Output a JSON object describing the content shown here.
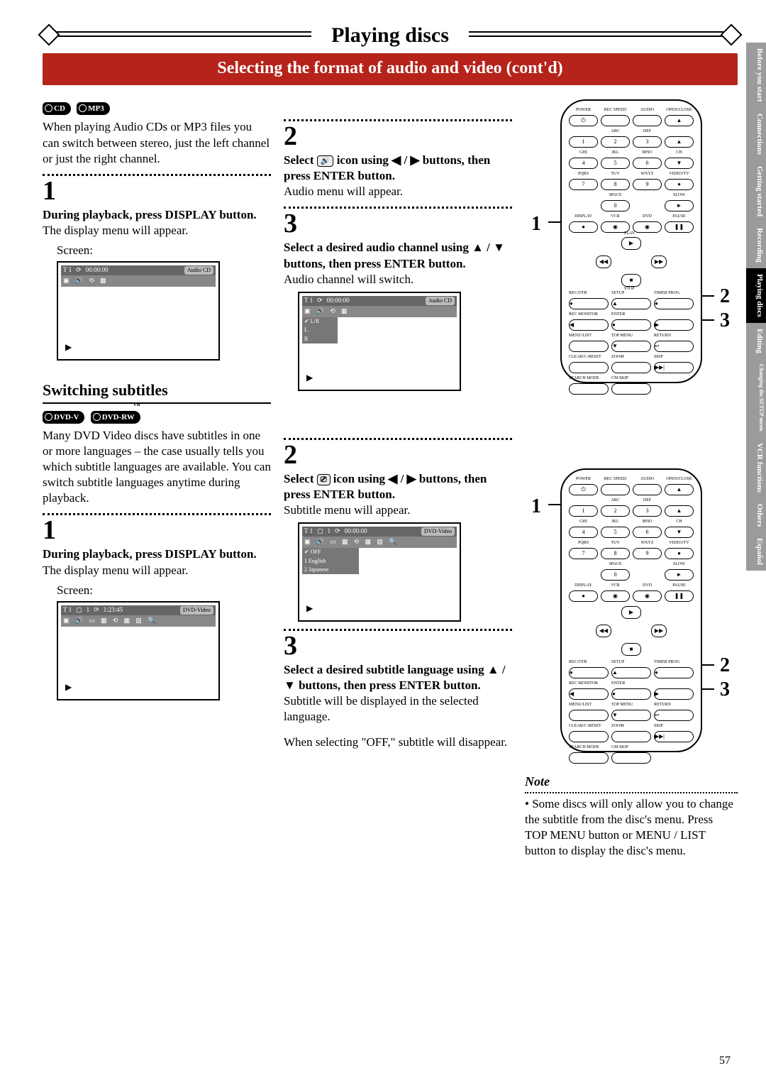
{
  "banner": {
    "title": "Playing discs"
  },
  "section_bar": "Selecting the format of audio and video (cont'd)",
  "tabs": [
    {
      "label": "Before you start",
      "active": false
    },
    {
      "label": "Connections",
      "active": false
    },
    {
      "label": "Getting started",
      "active": false
    },
    {
      "label": "Recording",
      "active": false
    },
    {
      "label": "Playing discs",
      "active": true
    },
    {
      "label": "Editing",
      "active": false
    },
    {
      "label": "Changing the SETUP menu",
      "active": false
    },
    {
      "label": "VCR functions",
      "active": false
    },
    {
      "label": "Others",
      "active": false
    },
    {
      "label": "Español",
      "active": false
    }
  ],
  "sec1": {
    "badges": [
      "CD",
      "MP3"
    ],
    "intro": "When playing Audio CDs or MP3 files you can switch between stereo, just the left channel or just the right channel.",
    "steps": {
      "1": {
        "n": "1",
        "bold": "During playback, press DISPLAY button.",
        "text": "The display menu will appear.",
        "screen_label": "Screen:",
        "screen": {
          "track": "T  1",
          "time": "00:00:00",
          "type": "Audio CD"
        }
      },
      "2": {
        "n": "2",
        "bold_pre": "Select ",
        "bold_mid": " icon using ",
        "arrows": "◀ / ▶",
        "bold_post": " buttons, then press ENTER button.",
        "text": "Audio menu will appear."
      },
      "3": {
        "n": "3",
        "bold": "Select a desired audio channel using ▲ / ▼ buttons, then press ENTER button.",
        "text": "Audio channel will switch.",
        "screen": {
          "track": "T  1",
          "time": "00:00:00",
          "type": "Audio CD",
          "menu": [
            "✔ L/R",
            "  L",
            "  R"
          ]
        }
      }
    }
  },
  "sec2": {
    "title": "Switching subtitles",
    "badges": [
      "DVD-V",
      "DVD-RW"
    ],
    "vr_label": "VR",
    "intro": "Many DVD Video discs have subtitles in one or more languages – the case usually tells you which subtitle languages are available. You can switch subtitle languages anytime during playback.",
    "steps": {
      "1": {
        "n": "1",
        "bold": "During playback, press DISPLAY button.",
        "text": "The display menu will appear.",
        "screen_label": "Screen:",
        "screen": {
          "track": "T  1",
          "chap": "1",
          "time": "1:23:45",
          "type": "DVD-Video"
        }
      },
      "2": {
        "n": "2",
        "bold_pre": "Select ",
        "bold_mid": " icon using ",
        "arrows": "◀ / ▶",
        "bold_post": " buttons, then press ENTER button.",
        "text": "Subtitle menu will appear.",
        "screen": {
          "track": "T  1",
          "chap": "1",
          "time": "00:00:00",
          "type": "DVD-Video",
          "menu": [
            "✔ OFF",
            "  1 English",
            "  2 Japanese"
          ]
        }
      },
      "3": {
        "n": "3",
        "bold": "Select a desired subtitle language using ▲ / ▼ buttons, then press ENTER button.",
        "text": "Subtitle will be displayed in the selected language.",
        "text2": "When selecting \"OFF,\" subtitle will disappear."
      }
    }
  },
  "remote": {
    "row_labels": [
      [
        "POWER",
        "REC SPEED",
        "AUDIO",
        "OPEN/CLOSE"
      ],
      [
        "",
        "ABC",
        "DEF",
        ""
      ],
      [
        "GHI",
        "JKL",
        "MNO",
        "CH"
      ],
      [
        "PQRS",
        "TUV",
        "WXYZ",
        "VIDEO/TV"
      ],
      [
        "",
        "SPACE",
        "",
        "SLOW"
      ],
      [
        "DISPLAY",
        "VCR",
        "DVD",
        "PAUSE"
      ]
    ],
    "numbers": [
      [
        "⏻/I",
        "1",
        "2",
        "3",
        "▲"
      ],
      [
        "4",
        "5",
        "6",
        "▼"
      ],
      [
        "7",
        "8",
        "9",
        "●"
      ],
      [
        "0",
        "►"
      ],
      [
        "●",
        "◉",
        "◉",
        "❚❚"
      ]
    ],
    "nav": {
      "play": "PLAY",
      "stop": "STOP",
      "prev": "◀◀",
      "next": "▶▶"
    },
    "bottom_labels": [
      [
        "REC/OTR",
        "SETUP",
        "",
        "TIMER PROG."
      ],
      [
        "REC MONITOR",
        "",
        "ENTER",
        ""
      ],
      [
        "MENU/LIST",
        "TOP MENU",
        "",
        "RETURN"
      ],
      [
        "CLEAR/C-RESET",
        "ZOOM",
        "SKIP",
        "SKIP"
      ],
      [
        "SEARCH MODE",
        "CM SKIP",
        "",
        ""
      ]
    ],
    "callouts_a": {
      "c1": "1",
      "c2": "2",
      "c3": "3"
    },
    "callouts_b": {
      "c1": "1",
      "c2": "2",
      "c3": "3"
    }
  },
  "note": {
    "title": "Note",
    "bullet": "•",
    "text": "Some discs will only allow you to change the subtitle from the disc's menu. Press TOP MENU button or MENU / LIST button to display the disc's menu."
  },
  "page_number": "57"
}
